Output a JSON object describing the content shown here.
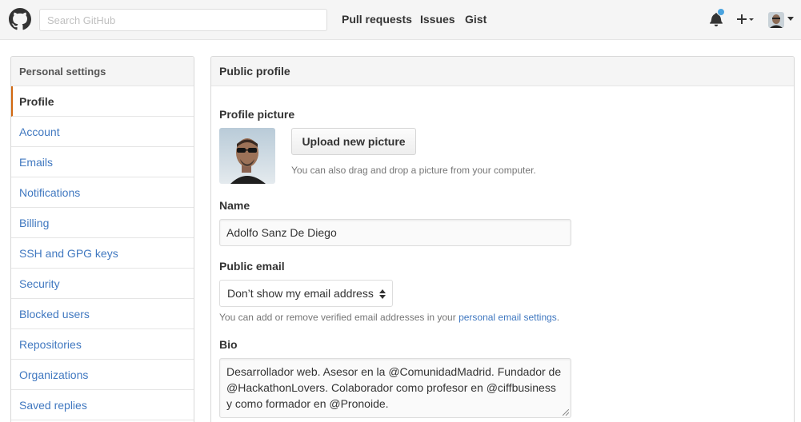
{
  "header": {
    "search_placeholder": "Search GitHub",
    "nav": [
      "Pull requests",
      "Issues",
      "Gist"
    ],
    "icons": [
      "github-logo",
      "bell-icon",
      "plus-icon",
      "avatar",
      "caret-down-icon"
    ],
    "notification_color": "#4aa3df"
  },
  "sidebar": {
    "title": "Personal settings",
    "items": [
      {
        "label": "Profile",
        "selected": true
      },
      {
        "label": "Account"
      },
      {
        "label": "Emails"
      },
      {
        "label": "Notifications"
      },
      {
        "label": "Billing"
      },
      {
        "label": "SSH and GPG keys"
      },
      {
        "label": "Security"
      },
      {
        "label": "Blocked users"
      },
      {
        "label": "Repositories"
      },
      {
        "label": "Organizations"
      },
      {
        "label": "Saved replies"
      }
    ],
    "link_color": "#4078c0",
    "selected_accent": "#d26911"
  },
  "main": {
    "title": "Public profile",
    "picture": {
      "label": "Profile picture",
      "upload_button": "Upload new picture",
      "note": "You can also drag and drop a picture from your computer."
    },
    "name": {
      "label": "Name",
      "value": "Adolfo Sanz De Diego"
    },
    "email": {
      "label": "Public email",
      "selected": "Don’t show my email address",
      "note_prefix": "You can add or remove verified email addresses in your ",
      "note_link": "personal email settings",
      "note_suffix": "."
    },
    "bio": {
      "label": "Bio",
      "value": "Desarrollador web. Asesor en la @ComunidadMadrid. Fundador de @HackathonLovers. Colaborador como profesor en @ciffbusiness y como formador en @Pronoide."
    }
  }
}
